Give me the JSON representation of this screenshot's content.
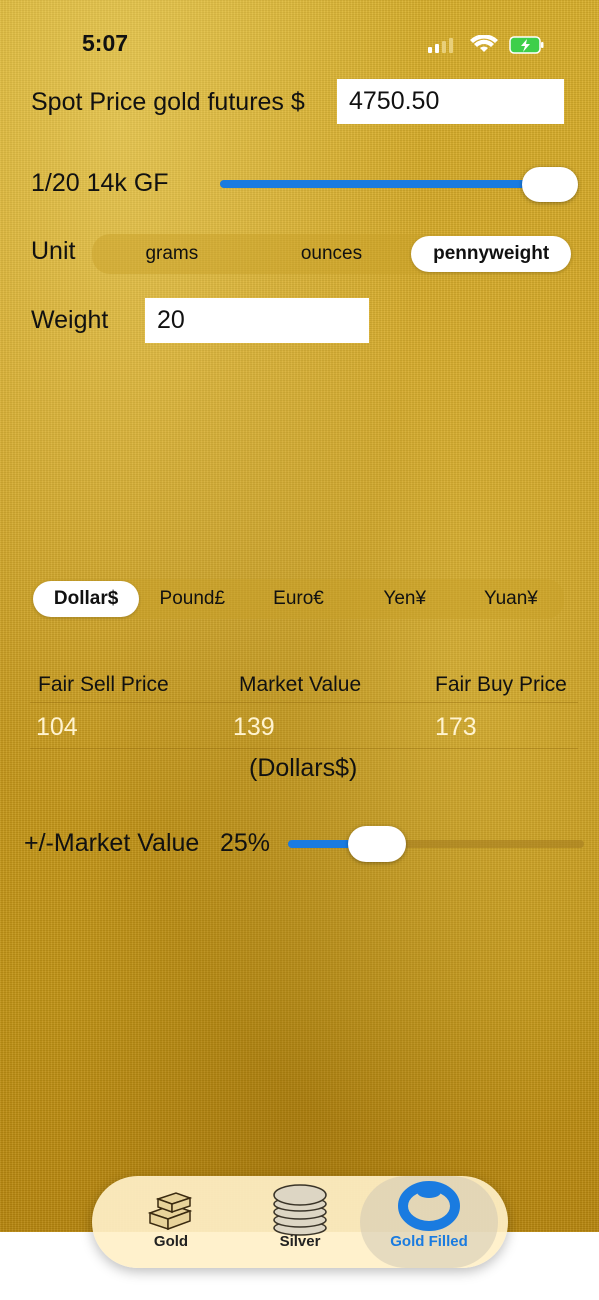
{
  "status_bar": {
    "time": "5:07"
  },
  "spot_price": {
    "label": "Spot Price gold futures $",
    "value": "4750.50"
  },
  "karat_slider": {
    "label": "1/20 14k GF",
    "level": 1.0
  },
  "unit": {
    "label": "Unit",
    "options": [
      "grams",
      "ounces",
      "pennyweight"
    ],
    "selected": "pennyweight"
  },
  "weight": {
    "label": "Weight",
    "value": "20"
  },
  "currency": {
    "options": [
      "Dollar$",
      "Pound£",
      "Euro€",
      "Yen¥",
      "Yuan¥"
    ],
    "selected": "Dollar$"
  },
  "prices": {
    "headers": [
      "Fair Sell Price",
      "Market Value",
      "Fair Buy Price"
    ],
    "values": [
      "104",
      "139",
      "173"
    ],
    "currency_note": "(Dollars$)"
  },
  "market_slider": {
    "label": "+/-Market Value",
    "value_text": "25%",
    "level": 0.25
  },
  "tabs": [
    {
      "label": "Gold",
      "icon": "gold-bars-icon"
    },
    {
      "label": "Silver",
      "icon": "silver-coins-icon"
    },
    {
      "label": "Gold Filled",
      "icon": "gold-filled-ring-icon"
    }
  ],
  "colors": {
    "accent": "#1a7be0",
    "selected_tab": "#1a7be0"
  }
}
